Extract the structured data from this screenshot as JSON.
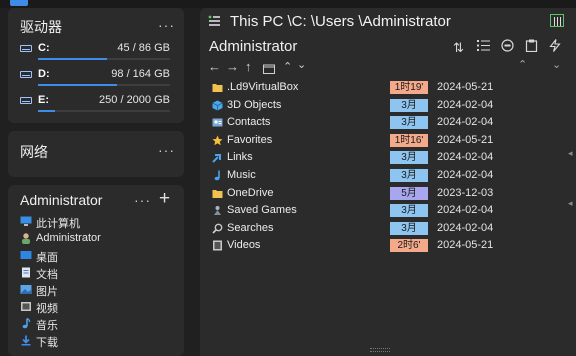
{
  "drives_panel": {
    "title": "驱动器",
    "drives": [
      {
        "name": "C:",
        "size": "45 / 86 GB",
        "fill": 0.52
      },
      {
        "name": "D:",
        "size": "98 / 164 GB",
        "fill": 0.6
      },
      {
        "name": "E:",
        "size": "250 / 2000 GB",
        "fill": 0.125
      }
    ]
  },
  "network_panel": {
    "title": "网络"
  },
  "user_panel": {
    "title": "Administrator",
    "add": "+",
    "items": [
      {
        "label": "此计算机",
        "icon": "computer-icon"
      },
      {
        "label": "Administrator",
        "icon": "user-icon"
      },
      {
        "label": "桌面",
        "icon": "desktop-icon"
      },
      {
        "label": "文档",
        "icon": "document-icon"
      },
      {
        "label": "图片",
        "icon": "picture-icon"
      },
      {
        "label": "视频",
        "icon": "video-icon"
      },
      {
        "label": "音乐",
        "icon": "music-icon"
      },
      {
        "label": "下载",
        "icon": "download-icon"
      }
    ]
  },
  "main": {
    "path": "This PC \\C: \\Users \\Administrator",
    "title": "Administrator",
    "files": [
      {
        "name": ".Ld9VirtualBox",
        "time": "1时19'",
        "date": "2024-05-21",
        "tone": "orange",
        "icon": "folder-icon"
      },
      {
        "name": "3D Objects",
        "time": "3月",
        "date": "2024-02-04",
        "tone": "blue",
        "icon": "cube-icon"
      },
      {
        "name": "Contacts",
        "time": "3月",
        "date": "2024-02-04",
        "tone": "blue",
        "icon": "contacts-icon"
      },
      {
        "name": "Favorites",
        "time": "1时16'",
        "date": "2024-05-21",
        "tone": "orange",
        "icon": "star-icon"
      },
      {
        "name": "Links",
        "time": "3月",
        "date": "2024-02-04",
        "tone": "blue",
        "icon": "link-icon"
      },
      {
        "name": "Music",
        "time": "3月",
        "date": "2024-02-04",
        "tone": "blue",
        "icon": "music-icon"
      },
      {
        "name": "OneDrive",
        "time": "5月",
        "date": "2023-12-03",
        "tone": "purple",
        "icon": "folder-icon"
      },
      {
        "name": "Saved Games",
        "time": "3月",
        "date": "2024-02-04",
        "tone": "blue",
        "icon": "games-icon"
      },
      {
        "name": "Searches",
        "time": "3月",
        "date": "2024-02-04",
        "tone": "blue",
        "icon": "search-icon"
      },
      {
        "name": "Videos",
        "time": "2时6'",
        "date": "2024-05-21",
        "tone": "orange",
        "icon": "video-icon"
      }
    ]
  },
  "colors": {
    "accent": "#3f8ce8",
    "orange": "#f4a98a",
    "blue": "#8ec5f0",
    "purple": "#a8a6ee",
    "folder": "#f2c14e"
  }
}
